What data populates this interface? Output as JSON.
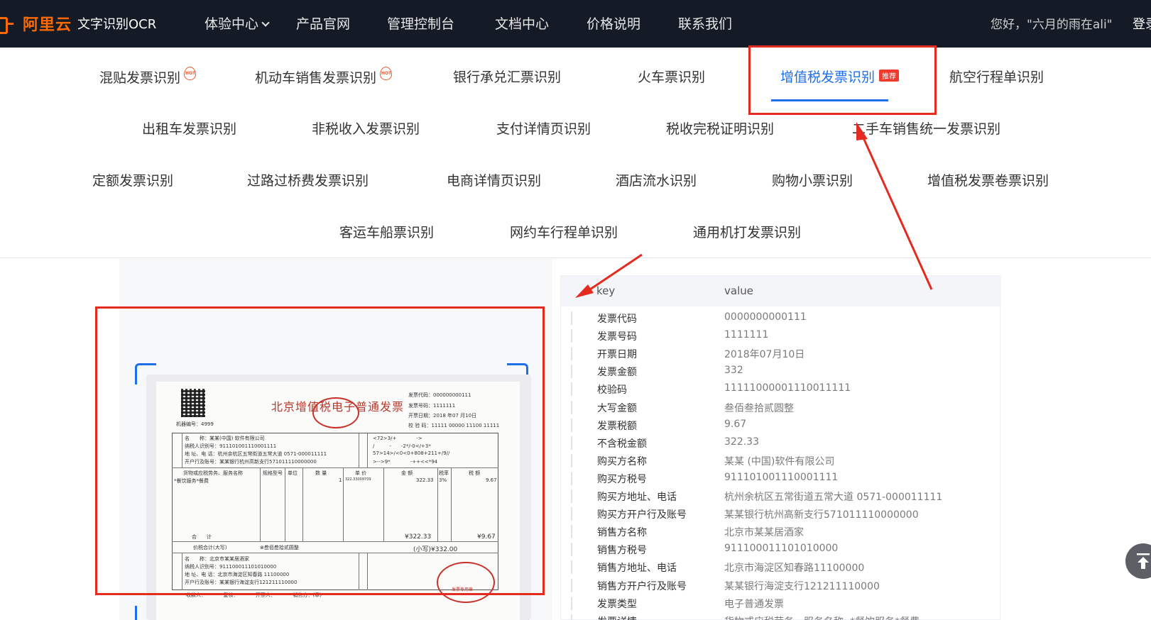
{
  "header": {
    "brand": "阿里云",
    "product": "文字识别OCR",
    "nav": [
      "体验中心",
      "产品官网",
      "管理控制台",
      "文档中心",
      "价格说明",
      "联系我们"
    ],
    "greeting": "您好，\"六月的雨在ali\"",
    "login": "登录"
  },
  "categories": {
    "row1": [
      "混贴发票识别",
      "机动车销售发票识别",
      "银行承兑汇票识别",
      "火车票识别",
      "增值税发票识别",
      "航空行程单识别"
    ],
    "row2": [
      "出租车发票识别",
      "非税收入发票识别",
      "支付详情页识别",
      "税收完税证明识别",
      "二手车销售统一发票识别"
    ],
    "row3": [
      "定额发票识别",
      "过路过桥费发票识别",
      "电商详情页识别",
      "酒店流水识别",
      "购物小票识别",
      "增值税发票卷票识别"
    ],
    "row4": [
      "客运车船票识别",
      "网约车行程单识别",
      "通用机打发票识别"
    ],
    "hot_badge": "HOT",
    "recommend_badge": "推荐"
  },
  "invoice": {
    "title": "北京增值税电子普通发票",
    "machine_no": "机器编号：4999",
    "code_line": "发票代码：000000000111",
    "number_line": "发票号码：1111111",
    "date_line": "开票日期：2018 年07 月10日",
    "check_line": "校 验 码：11111 00000 11100 11111",
    "buyer_name": "名　　称：某某(中国) 软件有限公司",
    "buyer_tax": "纳税人识别号：911101001110001111",
    "buyer_addr": "地 址、电 话：杭州余杭区五常街道五常大道 0571-000011111",
    "buyer_bank": "开户行及账号：某某银行杭州高新支行571011110000000",
    "cipher1": "<72>3/+　　　　->",
    "cipher2": "/　　　-　　-2*/-0</+3*",
    "cipher3": "57>14>/<0<0+808+211+/9//",
    "cipher4": ">-->9*　　　　-++<<*94",
    "goods_header": "货物或应税劳务、服务名称",
    "spec_header": "规格型号",
    "unit_header": "单位",
    "qty_header": "数 量",
    "price_header": "单 价",
    "amount_header": "金 额",
    "rate_header": "税率",
    "tax_header": "税 额",
    "goods_item": "*餐饮服务*餐费",
    "qty": "1",
    "price": "322.33009709",
    "amount": "322.33",
    "rate": "3%",
    "tax": "9.67",
    "total_label": "合　　计",
    "total_amount": "¥322.33",
    "total_tax": "¥9.67",
    "grand_label": "价税合计(大写)",
    "grand_cn": "⊗叁佰叁拾贰圆整",
    "grand_num": "(小写)¥332.00",
    "seller_name": "名　　称：北京市某某居酒家",
    "seller_tax": "纳税人识别号：911100011101010000",
    "seller_addr": "地 址、电 话：北京市海淀区知春路 11100000",
    "seller_bank": "开户行及账号：某某银行海淀支行121211110000",
    "footer": "收款人：　　　　复核：　　　　开票人：　　　　销售方：(章)",
    "seal_text": "发票专用章"
  },
  "result": {
    "key_header": "key",
    "value_header": "value",
    "rows": [
      {
        "k": "发票代码",
        "v": "0000000000111"
      },
      {
        "k": "发票号码",
        "v": "1111111"
      },
      {
        "k": "开票日期",
        "v": "2018年07月10日"
      },
      {
        "k": "发票金额",
        "v": "332"
      },
      {
        "k": "校验码",
        "v": "11111000001110011111"
      },
      {
        "k": "大写金额",
        "v": "叁佰叁拾贰圆整"
      },
      {
        "k": "发票税额",
        "v": "9.67"
      },
      {
        "k": "不含税金额",
        "v": "322.33"
      },
      {
        "k": "购买方名称",
        "v": "某某 (中国)软件有限公司"
      },
      {
        "k": "购买方税号",
        "v": "911101001110001111"
      },
      {
        "k": "购买方地址、电话",
        "v": "杭州余杭区五常街道五常大道 0571-000011111"
      },
      {
        "k": "购买方开户行及账号",
        "v": "某某银行杭州高新支行571011110000000"
      },
      {
        "k": "销售方名称",
        "v": "北京市某某居酒家"
      },
      {
        "k": "销售方税号",
        "v": "911100011101010000"
      },
      {
        "k": "销售方地址、电话",
        "v": "北京市海淀区知春路11100000"
      },
      {
        "k": "销售方开户行及账号",
        "v": "某某银行海淀支行121211110000"
      },
      {
        "k": "发票类型",
        "v": "电子普通发票"
      },
      {
        "k": "发票详情",
        "v": "货物或应税劳务、服务名称: *餐饮服务*餐费"
      }
    ]
  },
  "colors": {
    "accent": "#1f6feb",
    "highlight": "#e52a1f",
    "nav_bg": "#151b26",
    "brand": "#ff6a00"
  },
  "icons": {
    "back_to_top": "arrow-up-to-line-icon",
    "hot": "hot-flame-icon"
  }
}
